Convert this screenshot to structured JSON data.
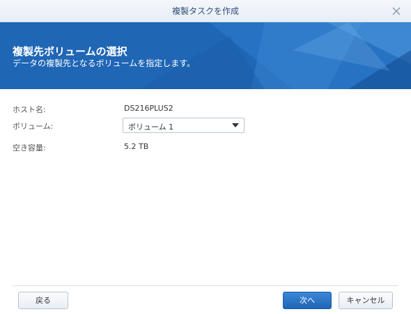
{
  "window": {
    "title": "複製タスクを作成"
  },
  "banner": {
    "heading": "複製先ボリュームの選択",
    "subheading": "データの複製先となるボリュームを指定します。"
  },
  "form": {
    "host": {
      "label": "ホスト名:",
      "value": "DS216PLUS2"
    },
    "volume": {
      "label": "ボリューム:",
      "selected": "ボリューム 1"
    },
    "free_space": {
      "label": "空き容量:",
      "value": "5.2 TB"
    }
  },
  "buttons": {
    "back": "戻る",
    "next": "次へ",
    "cancel": "キャンセル"
  },
  "colors": {
    "banner_blue": "#1f66b5",
    "primary_button": "#2a74c6"
  }
}
